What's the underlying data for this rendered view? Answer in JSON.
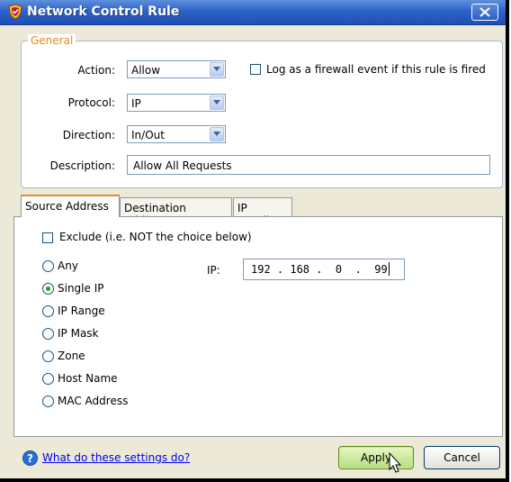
{
  "window": {
    "title": "Network Control Rule"
  },
  "general": {
    "legend": "General",
    "action_label": "Action:",
    "action_value": "Allow",
    "log_checkbox_label": "Log as a firewall event if this rule is fired",
    "log_checked": false,
    "protocol_label": "Protocol:",
    "protocol_value": "IP",
    "direction_label": "Direction:",
    "direction_value": "In/Out",
    "description_label": "Description:",
    "description_value": "Allow All Requests"
  },
  "tabs": [
    {
      "label": "Source Address",
      "active": true
    },
    {
      "label": "Destination Address",
      "active": false
    },
    {
      "label": "IP Details",
      "active": false
    }
  ],
  "source": {
    "exclude_label": "Exclude (i.e. NOT the choice below)",
    "exclude_checked": false,
    "options": [
      {
        "label": "Any",
        "selected": false
      },
      {
        "label": "Single IP",
        "selected": true
      },
      {
        "label": "IP Range",
        "selected": false
      },
      {
        "label": "IP Mask",
        "selected": false
      },
      {
        "label": "Zone",
        "selected": false
      },
      {
        "label": "Host Name",
        "selected": false
      },
      {
        "label": "MAC Address",
        "selected": false
      }
    ],
    "ip_label": "IP:",
    "ip_value": "192 . 168 .  0  .  99"
  },
  "footer": {
    "help_link": "What do these settings do?",
    "apply_label": "Apply",
    "cancel_label": "Cancel"
  },
  "colors": {
    "title_bar": "#2e63c8",
    "legend": "#e38a1c",
    "apply_button": "#b7dd7e",
    "radio_dot": "#21a121"
  }
}
